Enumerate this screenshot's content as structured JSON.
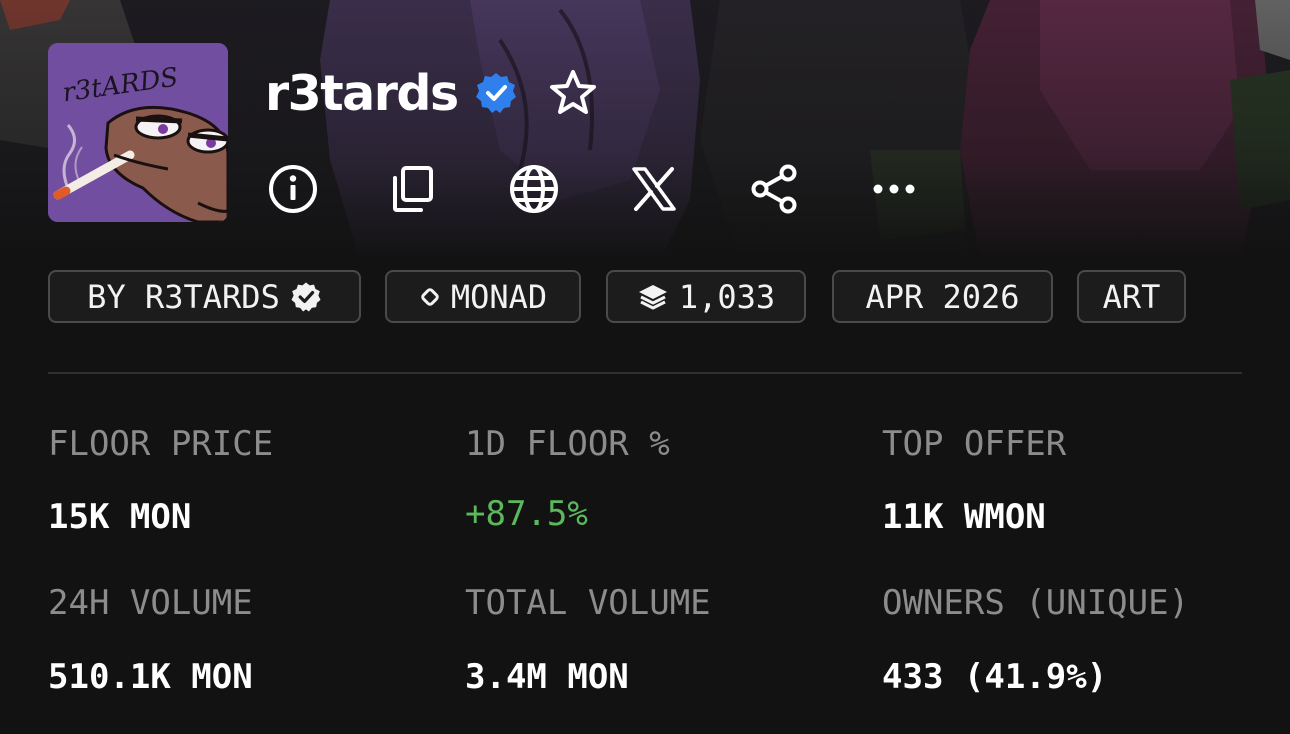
{
  "collection": {
    "name": "r3tards",
    "verified": true,
    "avatar_text": "r3tARDS"
  },
  "actions": [
    "info-icon",
    "copy-icon",
    "globe-icon",
    "x-logo-icon",
    "share-icon",
    "more-icon"
  ],
  "tags": [
    {
      "label": "BY R3TARDS",
      "icon": "verified-badge-icon"
    },
    {
      "label": "MONAD",
      "icon": "chain-icon"
    },
    {
      "label": "1,033",
      "icon": "layers-icon"
    },
    {
      "label": "APR 2026",
      "icon": ""
    },
    {
      "label": "ART",
      "icon": ""
    }
  ],
  "stats": [
    {
      "label": "FLOOR PRICE",
      "value": "15K MON"
    },
    {
      "label": "1D FLOOR %",
      "value": "+87.5%",
      "positive": true
    },
    {
      "label": "TOP OFFER",
      "value": "11K WMON"
    },
    {
      "label": "24H VOLUME",
      "value": "510.1K MON"
    },
    {
      "label": "TOTAL VOLUME",
      "value": "3.4M MON"
    },
    {
      "label": "OWNERS (UNIQUE)",
      "value": "433 (41.9%)"
    }
  ],
  "colors": {
    "background": "#121212",
    "verified": "#2f80ed",
    "positive": "#5cb85c",
    "label": "#8c8c8c"
  }
}
